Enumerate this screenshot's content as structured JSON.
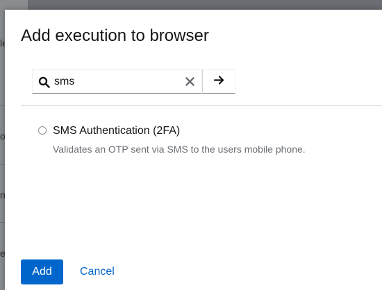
{
  "background_page": {
    "fragments": [
      "le",
      "oc",
      "n",
      "e"
    ]
  },
  "modal": {
    "title": "Add execution to browser",
    "search": {
      "value": "sms",
      "placeholder": "",
      "clear_icon": "close-icon",
      "submit_icon": "arrow-right-icon",
      "search_icon": "search-icon"
    },
    "results": [
      {
        "title": "SMS Authentication (2FA)",
        "description": "Validates an OTP sent via SMS to the users mobile phone.",
        "selected": false
      }
    ],
    "footer": {
      "add_label": "Add",
      "cancel_label": "Cancel"
    }
  },
  "colors": {
    "primary": "#0066cc",
    "title_text": "#151515",
    "secondary_text": "#6a6e73",
    "backdrop": "#6a6e73"
  }
}
